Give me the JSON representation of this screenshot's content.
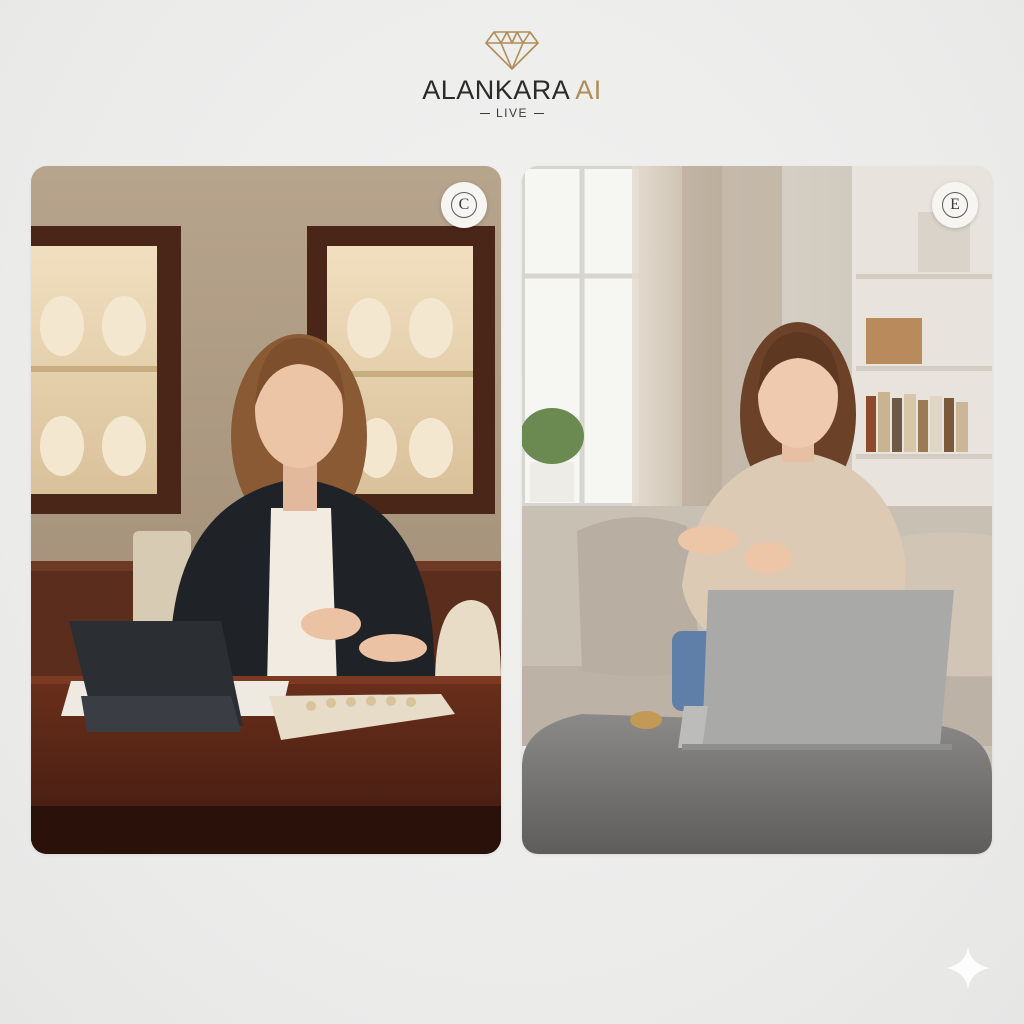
{
  "brand": {
    "name": "ALANKARA",
    "suffix": "AI",
    "subtitle": "LIVE",
    "logo_icon": "diamond-icon",
    "accent_color": "#b08d57"
  },
  "panels": [
    {
      "id": "consultant",
      "badge_letter": "C",
      "scene": "Consultant at jewelry showroom desk with tablet and necklace display"
    },
    {
      "id": "customer",
      "badge_letter": "E",
      "scene": "Customer on sofa at home with laptop trying on bracelet"
    }
  ],
  "decor": {
    "corner_icon": "sparkle-icon"
  }
}
